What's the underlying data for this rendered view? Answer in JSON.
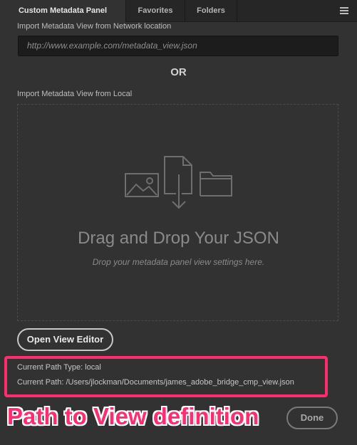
{
  "tabs": [
    {
      "label": "Custom Metadata Panel",
      "active": true
    },
    {
      "label": "Favorites",
      "active": false
    },
    {
      "label": "Folders",
      "active": false
    }
  ],
  "network": {
    "label": "Import Metadata View from Network location",
    "placeholder": "http://www.example.com/metadata_view.json"
  },
  "or_label": "OR",
  "local": {
    "label": "Import Metadata View from Local"
  },
  "dropzone": {
    "title": "Drag and Drop Your JSON",
    "subtitle": "Drop your metadata panel view settings here.",
    "icons": [
      "image-icon",
      "file-download-icon",
      "folder-icon"
    ]
  },
  "buttons": {
    "open_view_editor": "Open View Editor",
    "done": "Done"
  },
  "path_info": {
    "type_line": "Current Path Type: local",
    "path_line": "Current Path: /Users/jlockman/Documents/james_adobe_bridge_cmp_view.json"
  },
  "annotation": {
    "text": "Path to View definition",
    "color": "#ff2d6f"
  },
  "colors": {
    "background": "#323232",
    "tabbar": "#262626",
    "accent": "#ff2d6f"
  }
}
